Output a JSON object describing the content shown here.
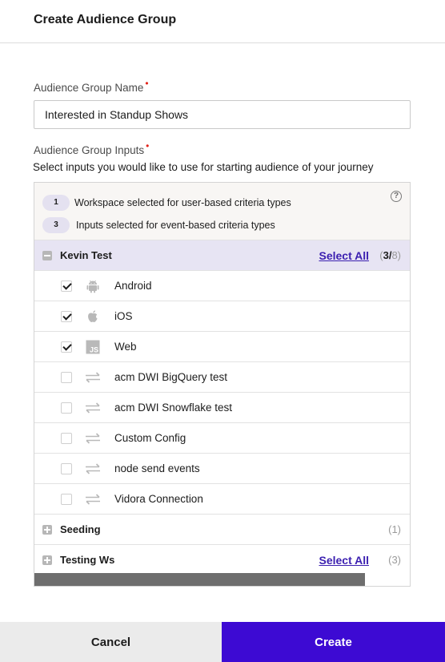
{
  "header": {
    "title": "Create Audience Group"
  },
  "form": {
    "name_label": "Audience Group Name",
    "required_mark": "•",
    "name_value": "Interested in Standup Shows",
    "inputs_label": "Audience Group Inputs",
    "helper_text": "Select inputs you would like to use for starting audience of your journey"
  },
  "info": {
    "rows": [
      {
        "count": "1",
        "text": "Workspace selected for user-based criteria types"
      },
      {
        "count": "3",
        "text": "Inputs selected for event-based criteria types"
      }
    ],
    "help_glyph": "?"
  },
  "groups": [
    {
      "name": "Kevin Test",
      "select_all": "Select All",
      "count_prefix": "(",
      "count_selected": "3/",
      "count_total": "8)",
      "expanded": true,
      "items": [
        {
          "label": "Android",
          "checked": true,
          "icon": "android-icon"
        },
        {
          "label": "iOS",
          "checked": true,
          "icon": "apple-icon"
        },
        {
          "label": "Web",
          "checked": true,
          "icon": "javascript-icon"
        },
        {
          "label": "acm DWI BigQuery test",
          "checked": false,
          "icon": "sync-arrows-icon"
        },
        {
          "label": "acm DWI Snowflake test",
          "checked": false,
          "icon": "sync-arrows-icon"
        },
        {
          "label": "Custom Config",
          "checked": false,
          "icon": "sync-arrows-icon"
        },
        {
          "label": "node send events",
          "checked": false,
          "icon": "sync-arrows-icon"
        },
        {
          "label": "Vidora Connection",
          "checked": false,
          "icon": "sync-arrows-icon"
        }
      ]
    },
    {
      "name": "Seeding",
      "count": "(1)",
      "expanded": false
    },
    {
      "name": "Testing Ws",
      "select_all": "Select All",
      "count": "(3)",
      "expanded": false
    }
  ],
  "horizontal_scroll_fraction": 0.88,
  "footer": {
    "cancel_label": "Cancel",
    "create_label": "Create"
  },
  "colors": {
    "accent": "#3d0ad3",
    "link": "#3b1fb0",
    "required": "#e2231a",
    "group_active_bg": "#e7e4f3"
  }
}
